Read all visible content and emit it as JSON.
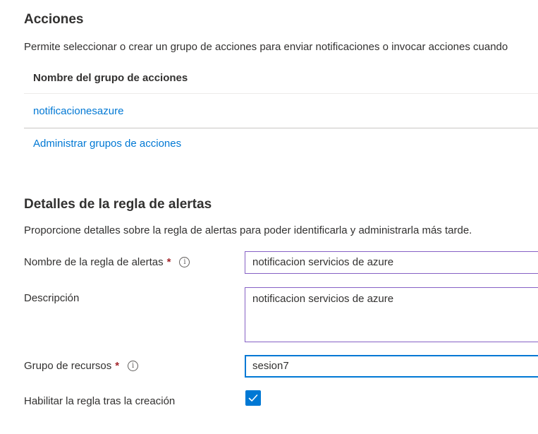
{
  "actions": {
    "title": "Acciones",
    "description": "Permite seleccionar o crear un grupo de acciones para enviar notificaciones o invocar acciones cuando",
    "table": {
      "column_header": "Nombre del grupo de acciones",
      "rows": [
        {
          "name": "notificacionesazure"
        }
      ]
    },
    "manage_link": "Administrar grupos de acciones"
  },
  "details": {
    "title": "Detalles de la regla de alertas",
    "description": "Proporcione detalles sobre la regla de alertas para poder identificarla y administrarla más tarde.",
    "rule_name": {
      "label": "Nombre de la regla de alertas",
      "required_mark": "*",
      "value": "notificacion servicios de azure"
    },
    "description_field": {
      "label": "Descripción",
      "value": "notificacion servicios de azure"
    },
    "resource_group": {
      "label": "Grupo de recursos",
      "required_mark": "*",
      "value": "sesion7"
    },
    "enable_rule": {
      "label": "Habilitar la regla tras la creación",
      "checked": true
    }
  },
  "colors": {
    "link": "#0078d4",
    "checkbox": "#0078d4",
    "required": "#a4262c",
    "focused_border": "#0078d4",
    "hover_border": "#8661c5"
  },
  "icons": {
    "info": "info-icon",
    "check": "checkmark-icon"
  }
}
